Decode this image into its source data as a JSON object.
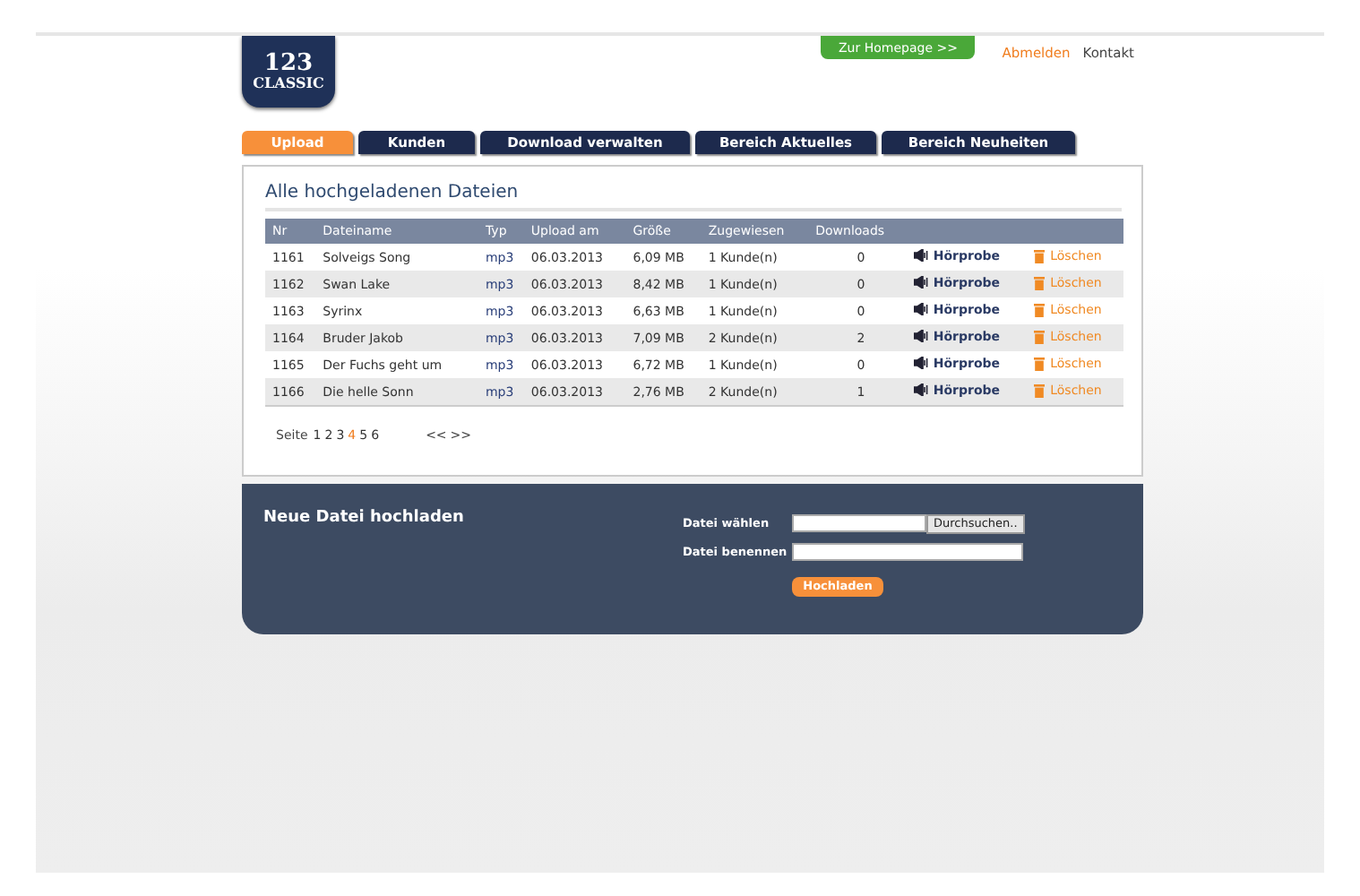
{
  "logo": {
    "line_1": "123",
    "line_2": "CLASSIC"
  },
  "header": {
    "homepage_button": "Zur Homepage >>",
    "links": [
      "Abmelden",
      "Kontakt"
    ]
  },
  "tabs": [
    {
      "label": "Upload",
      "selected": true
    },
    {
      "label": "Kunden",
      "selected": false
    },
    {
      "label": "Download verwalten",
      "selected": false
    },
    {
      "label": "Bereich Aktuelles",
      "selected": false
    },
    {
      "label": "Bereich Neuheiten",
      "selected": false
    }
  ],
  "files": {
    "title": "Alle hochgeladenen Dateien",
    "columns": [
      "Nr",
      "Dateiname",
      "Typ",
      "Upload am",
      "Größe",
      "Zugewiesen",
      "Downloads"
    ],
    "rows": [
      {
        "nr": "1161",
        "name": "Solveigs Song",
        "type": "mp3",
        "date": "06.03.2013",
        "size": "6,09 MB",
        "assigned": "1 Kunde(n)",
        "downloads": "0",
        "preview": "Hörprobe",
        "delete": "Löschen"
      },
      {
        "nr": "1162",
        "name": "Swan Lake",
        "type": "mp3",
        "date": "06.03.2013",
        "size": "8,42 MB",
        "assigned": "1 Kunde(n)",
        "downloads": "0",
        "preview": "Hörprobe",
        "delete": "Löschen"
      },
      {
        "nr": "1163",
        "name": "Syrinx",
        "type": "mp3",
        "date": "06.03.2013",
        "size": "6,63 MB",
        "assigned": "1 Kunde(n)",
        "downloads": "0",
        "preview": "Hörprobe",
        "delete": "Löschen"
      },
      {
        "nr": "1164",
        "name": "Bruder Jakob",
        "type": "mp3",
        "date": "06.03.2013",
        "size": "7,09 MB",
        "assigned": "2 Kunde(n)",
        "downloads": "2",
        "preview": "Hörprobe",
        "delete": "Löschen"
      },
      {
        "nr": "1165",
        "name": "Der Fuchs geht um",
        "type": "mp3",
        "date": "06.03.2013",
        "size": "6,72 MB",
        "assigned": "1 Kunde(n)",
        "downloads": "0",
        "preview": "Hörprobe",
        "delete": "Löschen"
      },
      {
        "nr": "1166",
        "name": "Die helle Sonn",
        "type": "mp3",
        "date": "06.03.2013",
        "size": "2,76 MB",
        "assigned": "2 Kunde(n)",
        "downloads": "1",
        "preview": "Hörprobe",
        "delete": "Löschen"
      }
    ],
    "pagination": {
      "label": "Seite",
      "pages": [
        {
          "label": "1",
          "selected": false
        },
        {
          "label": "2",
          "selected": false
        },
        {
          "label": "3",
          "selected": false
        },
        {
          "label": "4",
          "selected": true
        },
        {
          "label": "5",
          "selected": false
        },
        {
          "label": "6",
          "selected": false
        }
      ],
      "prev": "<<",
      "next": ">>"
    }
  },
  "upload": {
    "title": "Neue Datei hochladen",
    "choose_label": "Datei wählen",
    "browse_button": "Durchsuchen..",
    "name_label": "Datei benennen",
    "submit_button": "Hochladen"
  }
}
